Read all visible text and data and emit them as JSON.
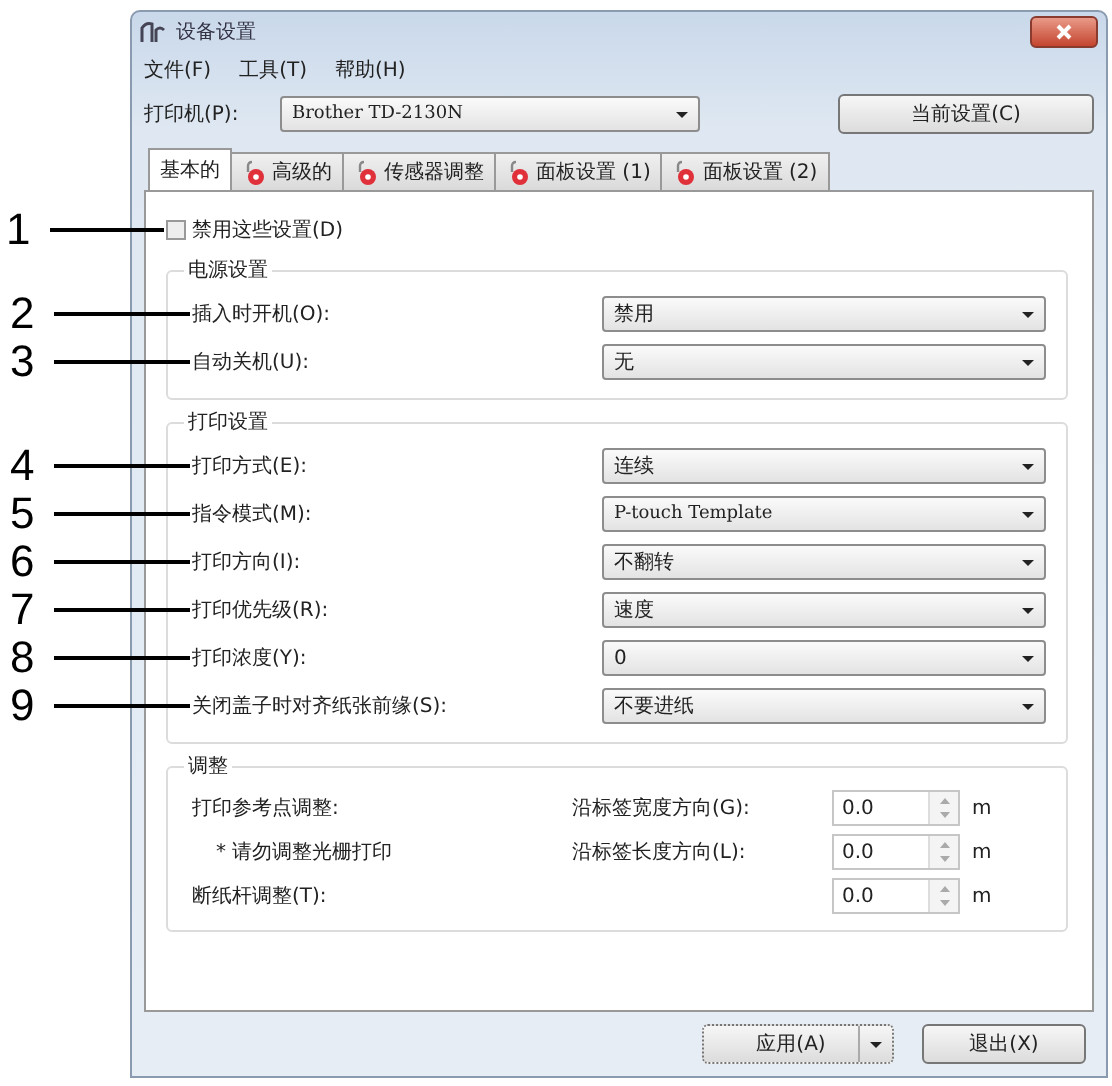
{
  "window": {
    "title": "设备设置"
  },
  "menu": [
    "文件(F)",
    "工具(T)",
    "帮助(H)"
  ],
  "printer": {
    "label": "打印机(P):",
    "value": "Brother TD-2130N"
  },
  "current_settings_button": "当前设置(C)",
  "tabs": [
    {
      "label": "基本的",
      "selected": true,
      "icon": false
    },
    {
      "label": "高级的",
      "selected": false,
      "icon": true
    },
    {
      "label": "传感器调整",
      "selected": false,
      "icon": true
    },
    {
      "label": "面板设置 (1)",
      "selected": false,
      "icon": true
    },
    {
      "label": "面板设置 (2)",
      "selected": false,
      "icon": true
    }
  ],
  "disable_settings": {
    "callout": "1",
    "label": "禁用这些设置(D)",
    "checked": false
  },
  "power_group": {
    "title": "电源设置",
    "rows": [
      {
        "callout": "2",
        "label": "插入时开机(O):",
        "value": "禁用"
      },
      {
        "callout": "3",
        "label": "自动关机(U):",
        "value": "无"
      }
    ]
  },
  "print_group": {
    "title": "打印设置",
    "rows": [
      {
        "callout": "4",
        "label": "打印方式(E):",
        "value": "连续"
      },
      {
        "callout": "5",
        "label": "指令模式(M):",
        "value": "P-touch Template"
      },
      {
        "callout": "6",
        "label": "打印方向(I):",
        "value": "不翻转"
      },
      {
        "callout": "7",
        "label": "打印优先级(R):",
        "value": "速度"
      },
      {
        "callout": "8",
        "label": "打印浓度(Y):",
        "value": "0"
      },
      {
        "callout": "9",
        "label": "关闭盖子时对齐纸张前缘(S):",
        "value": "不要进纸"
      }
    ]
  },
  "adjust_group": {
    "title": "调整",
    "rows": [
      {
        "label": "打印参考点调整:",
        "axis": "沿标签宽度方向(G):",
        "value": "0.0",
        "unit": "m"
      },
      {
        "label": "* 请勿调整光栅打印",
        "axis": "沿标签长度方向(L):",
        "value": "0.0",
        "unit": "m"
      },
      {
        "label": "断纸杆调整(T):",
        "value": "0.0",
        "unit": "m"
      }
    ]
  },
  "buttons": [
    {
      "label": "应用(A)",
      "kind": "split"
    },
    {
      "label": "退出(X)",
      "kind": "plain"
    }
  ]
}
